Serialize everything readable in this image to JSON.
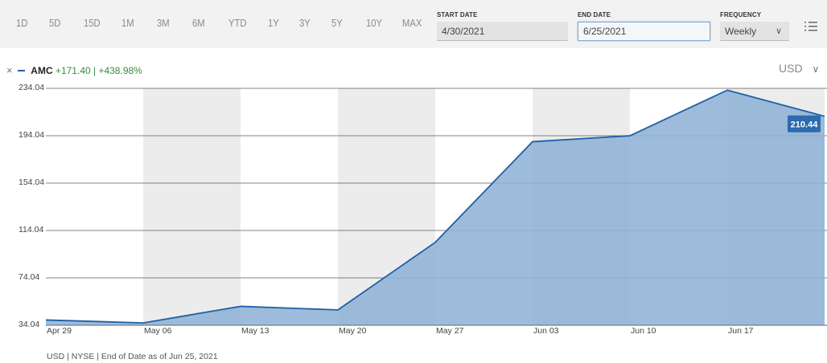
{
  "toolbar": {
    "ranges": [
      "1D",
      "5D",
      "15D",
      "1M",
      "3M",
      "6M",
      "YTD",
      "1Y",
      "3Y",
      "5Y",
      "10Y",
      "MAX"
    ],
    "start_date_label": "START DATE",
    "start_date_value": "4/30/2021",
    "end_date_label": "END DATE",
    "end_date_value": "6/25/2021",
    "frequency_label": "FREQUENCY",
    "frequency_value": "Weekly"
  },
  "legend": {
    "ticker": "AMC",
    "change": "+171.40 | +438.98%"
  },
  "currency": "USD",
  "footer": "USD | NYSE | End of Date as of Jun 25, 2021",
  "colors": {
    "line": "#1f5fa6",
    "area": "#8fb2d6",
    "band": "#ececec",
    "badge": "#2e6aad",
    "positive": "#3a8a3a"
  },
  "chart_data": {
    "type": "area",
    "series": [
      {
        "name": "AMC",
        "x": [
          "Apr 29",
          "May 06",
          "May 13",
          "May 20",
          "May 27",
          "Jun 03",
          "Jun 10",
          "Jun 17",
          "Jun 25"
        ],
        "values": [
          38.5,
          36.0,
          50.0,
          47.0,
          104.0,
          189.0,
          194.0,
          232.5,
          210.44
        ]
      }
    ],
    "x_tick_labels": [
      "Apr 29",
      "May 06",
      "May 13",
      "May 20",
      "May 27",
      "Jun 03",
      "Jun 10",
      "Jun 17"
    ],
    "y_ticks": [
      "234.04",
      "194.04",
      "154.04",
      "114.04",
      "74.04",
      "34.04"
    ],
    "ylim": [
      34.04,
      234.04
    ],
    "last_value_label": "210.44",
    "grid": true
  }
}
